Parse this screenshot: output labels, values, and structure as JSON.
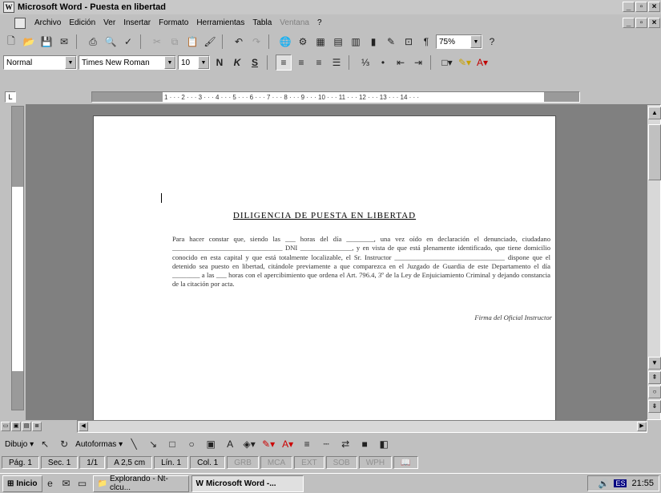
{
  "window": {
    "title": "Microsoft Word - Puesta en libertad",
    "app_icon": "word-icon"
  },
  "menubar": {
    "items": [
      "Archivo",
      "Edición",
      "Ver",
      "Insertar",
      "Formato",
      "Herramientas",
      "Tabla",
      "Ventana",
      "?"
    ]
  },
  "toolbar_standard": {
    "zoom": "75%"
  },
  "toolbar_format": {
    "style": "Normal",
    "font": "Times New Roman",
    "size": "10",
    "bold": "N",
    "italic": "K",
    "underline": "S"
  },
  "ruler": {
    "tick_text": "1 · · · 2 · · · 3 · · · 4 · · · 5 · · · 6 · · · 7 · · · 8 · · · 9 · · · 10 · · · 11 · · · 12 · · · 13 · · · 14 · · ·"
  },
  "document": {
    "title": "DILIGENCIA DE PUESTA EN LIBERTAD",
    "body": "Para hacer constar que, siendo las ___ horas del día ________, una vez oído en declaración el denunciado, ciudadano ________________________________ DNI _______________, y en vista de que está plenamente identificado, que tiene domicilio conocido en esta capital y que está totalmente localizable, el Sr. Instructor ________________________________ dispone que el detenido sea puesto en libertad, citándole previamente a que comparezca en el Juzgado de Guardia de este Departamento el día ________ a las ___ horas con el apercibimiento que ordena el Art. 796.4, 3º de la Ley de Enjuiciamiento Criminal y dejando constancia de la citación por acta.",
    "signature": "Firma del Oficial Instructor"
  },
  "drawbar": {
    "draw_label": "Dibujo",
    "autoshapes_label": "Autoformas"
  },
  "statusbar": {
    "page": "Pág. 1",
    "section": "Sec. 1",
    "pages": "1/1",
    "at": "A 2,5 cm",
    "line": "Lín. 1",
    "col": "Col. 1",
    "flags": [
      "GRB",
      "MCA",
      "EXT",
      "SOB",
      "WPH"
    ]
  },
  "taskbar": {
    "start": "Inicio",
    "tasks": [
      "Explorando - Nt-clcu...",
      "Microsoft Word -..."
    ],
    "clock": "21:55",
    "lang": "ES"
  }
}
